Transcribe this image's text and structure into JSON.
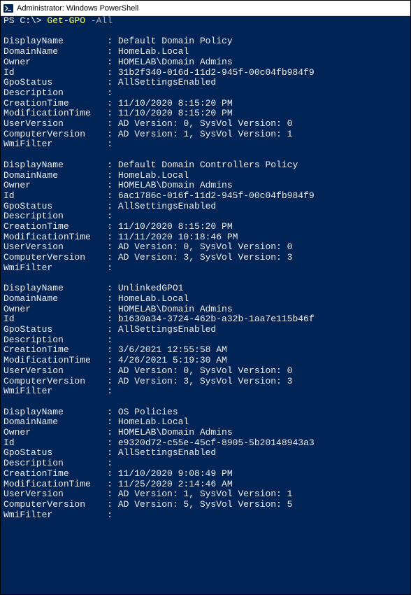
{
  "titlebar": {
    "title": "Administrator: Windows PowerShell"
  },
  "prompt": {
    "ps": "PS ",
    "path": "C:\\> ",
    "command": "Get-GPO",
    "param": " -All"
  },
  "records": [
    {
      "DisplayName": "Default Domain Policy",
      "DomainName": "HomeLab.Local",
      "Owner": "HOMELAB\\Domain Admins",
      "Id": "31b2f340-016d-11d2-945f-00c04fb984f9",
      "GpoStatus": "AllSettingsEnabled",
      "Description": "",
      "CreationTime": "11/10/2020 8:15:20 PM",
      "ModificationTime": "11/10/2020 8:15:20 PM",
      "UserVersion": "AD Version: 0, SysVol Version: 0",
      "ComputerVersion": "AD Version: 1, SysVol Version: 1",
      "WmiFilter": ""
    },
    {
      "DisplayName": "Default Domain Controllers Policy",
      "DomainName": "HomeLab.Local",
      "Owner": "HOMELAB\\Domain Admins",
      "Id": "6ac1786c-016f-11d2-945f-00c04fb984f9",
      "GpoStatus": "AllSettingsEnabled",
      "Description": "",
      "CreationTime": "11/10/2020 8:15:20 PM",
      "ModificationTime": "11/11/2020 10:18:46 PM",
      "UserVersion": "AD Version: 0, SysVol Version: 0",
      "ComputerVersion": "AD Version: 3, SysVol Version: 3",
      "WmiFilter": ""
    },
    {
      "DisplayName": "UnlinkedGPO1",
      "DomainName": "HomeLab.Local",
      "Owner": "HOMELAB\\Domain Admins",
      "Id": "b1630a34-3724-462b-a32b-1aa7e115b46f",
      "GpoStatus": "AllSettingsEnabled",
      "Description": "",
      "CreationTime": "3/6/2021 12:55:58 AM",
      "ModificationTime": "4/26/2021 5:19:30 AM",
      "UserVersion": "AD Version: 0, SysVol Version: 0",
      "ComputerVersion": "AD Version: 3, SysVol Version: 3",
      "WmiFilter": ""
    },
    {
      "DisplayName": "OS Policies",
      "DomainName": "HomeLab.Local",
      "Owner": "HOMELAB\\Domain Admins",
      "Id": "e9320d72-c55e-45cf-8905-5b20148943a3",
      "GpoStatus": "AllSettingsEnabled",
      "Description": "",
      "CreationTime": "11/10/2020 9:08:49 PM",
      "ModificationTime": "11/25/2020 2:14:46 AM",
      "UserVersion": "AD Version: 1, SysVol Version: 1",
      "ComputerVersion": "AD Version: 5, SysVol Version: 5",
      "WmiFilter": ""
    }
  ],
  "field_order": [
    "DisplayName",
    "DomainName",
    "Owner",
    "Id",
    "GpoStatus",
    "Description",
    "CreationTime",
    "ModificationTime",
    "UserVersion",
    "ComputerVersion",
    "WmiFilter"
  ]
}
